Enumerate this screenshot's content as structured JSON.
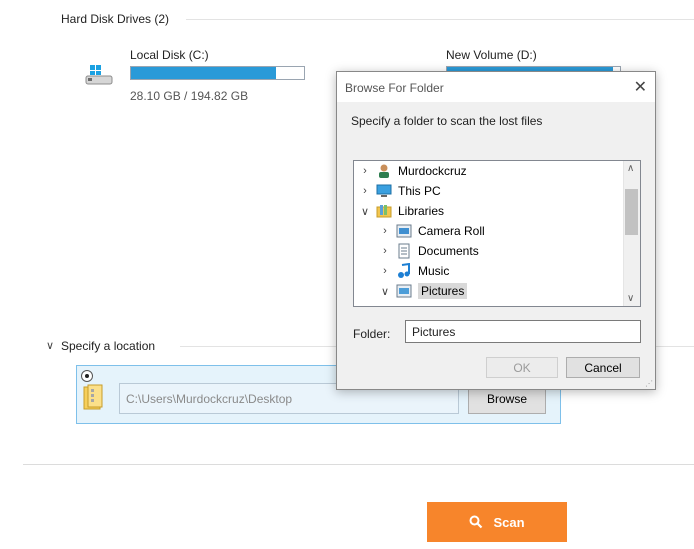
{
  "hard_disks": {
    "title": "Hard Disk Drives (2)",
    "disks": [
      {
        "name": "Local Disk (C:)",
        "size": "28.10 GB / 194.82 GB",
        "used_percent": 84
      },
      {
        "name": "New Volume (D:)",
        "size": "",
        "used_percent": 96
      }
    ]
  },
  "location": {
    "title": "Specify a location",
    "path_value": "C:\\Users\\Murdockcruz\\Desktop",
    "browse_label": "Browse"
  },
  "scan_label": "Scan",
  "dialog": {
    "title": "Browse For Folder",
    "instruction": "Specify a folder to scan the lost files",
    "tree": [
      {
        "label": "Murdockcruz",
        "icon": "user-folder-icon",
        "expander": ">",
        "level": 0
      },
      {
        "label": "This PC",
        "icon": "pc-icon",
        "expander": ">",
        "level": 0
      },
      {
        "label": "Libraries",
        "icon": "libraries-icon",
        "expander": "v",
        "level": 0
      },
      {
        "label": "Camera Roll",
        "icon": "camera-roll-icon",
        "expander": ">",
        "level": 1
      },
      {
        "label": "Documents",
        "icon": "documents-icon",
        "expander": ">",
        "level": 1
      },
      {
        "label": "Music",
        "icon": "music-icon",
        "expander": ">",
        "level": 1
      },
      {
        "label": "Pictures",
        "icon": "pictures-icon",
        "expander": "v",
        "level": 1,
        "selected": true
      }
    ],
    "folder_label": "Folder:",
    "folder_value": "Pictures",
    "ok_label": "OK",
    "cancel_label": "Cancel"
  },
  "colors": {
    "accent": "#2a9ad8",
    "scan": "#f7852b"
  }
}
